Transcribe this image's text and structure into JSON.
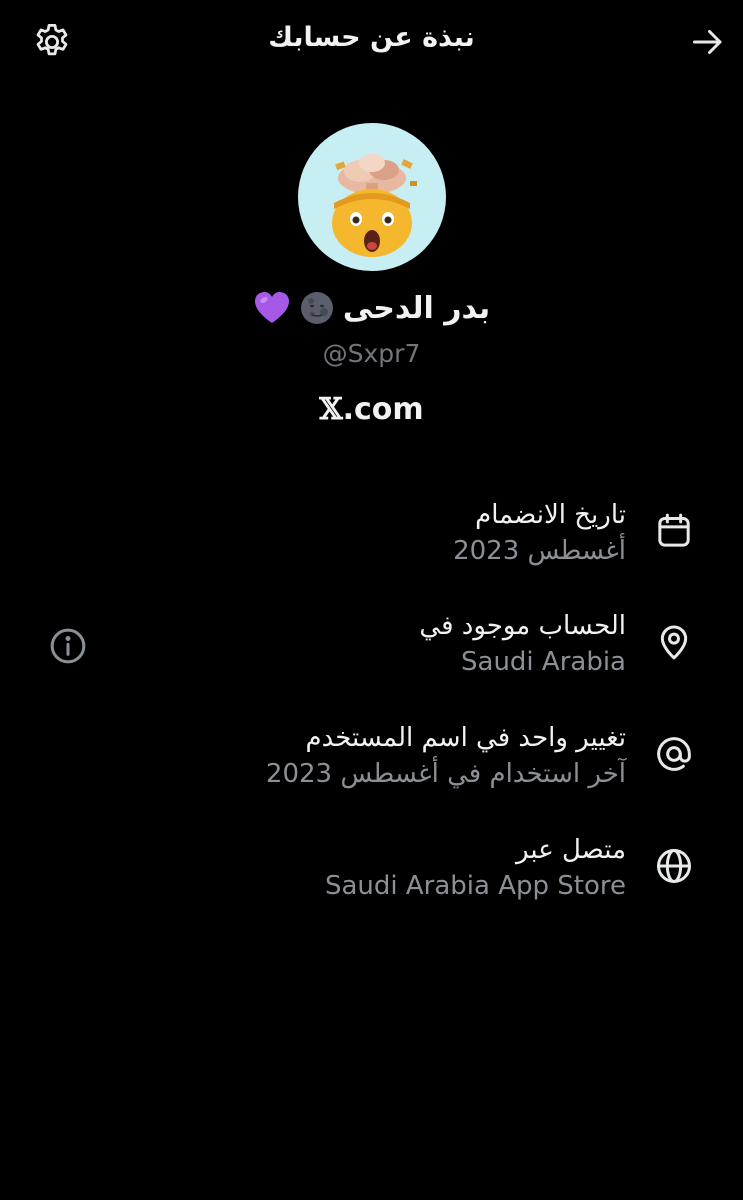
{
  "header": {
    "title": "نبذة عن حسابك",
    "settings_icon": "gear-icon",
    "back_icon": "arrow-right-icon"
  },
  "profile": {
    "display_name": "بدر الدحى",
    "emojis": [
      "new-moon-face",
      "purple-heart"
    ],
    "handle": "@Sxpr7",
    "site_x": "𝕏",
    "site_rest": ".com",
    "avatar_bg": "#c7eef2"
  },
  "items": [
    {
      "title": "تاريخ الانضمام",
      "value": "أغسطس 2023",
      "icon": "calendar-icon"
    },
    {
      "title": "الحساب موجود في",
      "value": "Saudi Arabia",
      "icon": "location-pin-icon"
    },
    {
      "title": "تغيير واحد في اسم المستخدم",
      "value": "آخر استخدام في أغسطس 2023",
      "icon": "at-sign-icon"
    },
    {
      "title": "متصل عبر",
      "value": "Saudi Arabia App Store",
      "icon": "globe-icon"
    }
  ],
  "info_icon": "info-icon"
}
